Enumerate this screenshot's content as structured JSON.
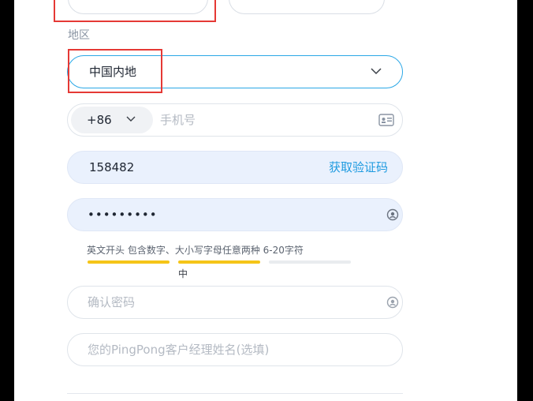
{
  "region": {
    "label": "地区",
    "selected": "中国内地"
  },
  "phone": {
    "country_code": "+86",
    "placeholder": "手机号"
  },
  "sms_code": {
    "value": "158482",
    "action_label": "获取验证码"
  },
  "password": {
    "masked_value": "•••••••••",
    "hint": "英文开头 包含数字、大小写字母任意两种 6-20字符",
    "strength_label": "中",
    "strength_level": 0.67,
    "bar_colors": [
      "#f5c518",
      "#f5c518",
      "#e9ecef"
    ]
  },
  "confirm_password": {
    "placeholder": "确认密码"
  },
  "manager": {
    "placeholder": "您的PingPong客户经理姓名(选填)"
  },
  "colors": {
    "accent": "#2aa7e6",
    "link": "#1f9be0",
    "filled_bg": "#eaf1fd",
    "highlight": "#e53935"
  }
}
